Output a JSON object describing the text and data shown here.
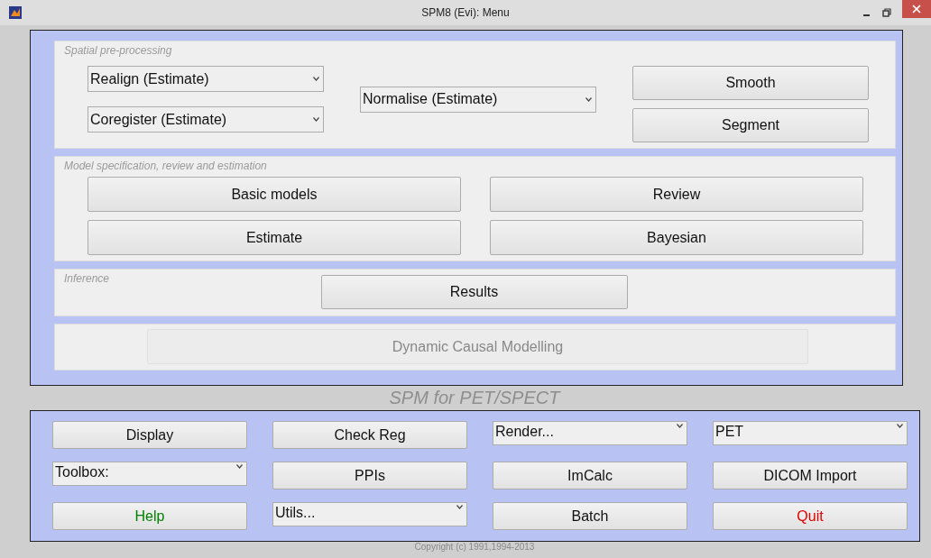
{
  "window": {
    "title": "SPM8 (Evi): Menu"
  },
  "sections": [
    {
      "kind": "preprocessing",
      "label": "Spatial pre-processing",
      "items": [
        {
          "kind": "dropdown",
          "label": "Realign (Estimate)",
          "disabled": false
        },
        {
          "kind": "dropdown",
          "label": "Coregister (Estimate)",
          "disabled": false
        },
        {
          "kind": "dropdown",
          "label": "Normalise (Estimate)",
          "disabled": false
        },
        {
          "kind": "button",
          "label": "Smooth",
          "disabled": false
        },
        {
          "kind": "button",
          "label": "Segment",
          "disabled": false
        }
      ]
    },
    {
      "kind": "grid",
      "label": "Model specification, review and estimation",
      "items": [
        {
          "kind": "button",
          "label": "Basic models",
          "disabled": false
        },
        {
          "kind": "button",
          "label": "Review",
          "disabled": false
        },
        {
          "kind": "button",
          "label": "Estimate",
          "disabled": false
        },
        {
          "kind": "button",
          "label": "Bayesian",
          "disabled": false
        }
      ]
    },
    {
      "kind": "single",
      "label": "Inference",
      "items": [
        {
          "kind": "button",
          "label": "Results",
          "disabled": false
        }
      ]
    },
    {
      "kind": "wide",
      "items": [
        {
          "kind": "button",
          "label": "Dynamic Causal Modelling",
          "disabled": true
        }
      ]
    }
  ],
  "modality_title": "SPM for PET/SPECT",
  "tools": [
    {
      "kind": "button",
      "label": "Display"
    },
    {
      "kind": "button",
      "label": "Check Reg"
    },
    {
      "kind": "dropdown",
      "label": "Render..."
    },
    {
      "kind": "dropdown",
      "label": "PET"
    },
    {
      "kind": "dropdown",
      "label": "Toolbox:"
    },
    {
      "kind": "button",
      "label": "PPIs"
    },
    {
      "kind": "button",
      "label": "ImCalc"
    },
    {
      "kind": "button",
      "label": "DICOM Import"
    },
    {
      "kind": "button",
      "label": "Help",
      "color": "#008000"
    },
    {
      "kind": "dropdown",
      "label": "Utils..."
    },
    {
      "kind": "button",
      "label": "Batch"
    },
    {
      "kind": "button",
      "label": "Quit",
      "color": "#e00000"
    }
  ],
  "copyright": "Copyright (c) 1991,1994-2013"
}
